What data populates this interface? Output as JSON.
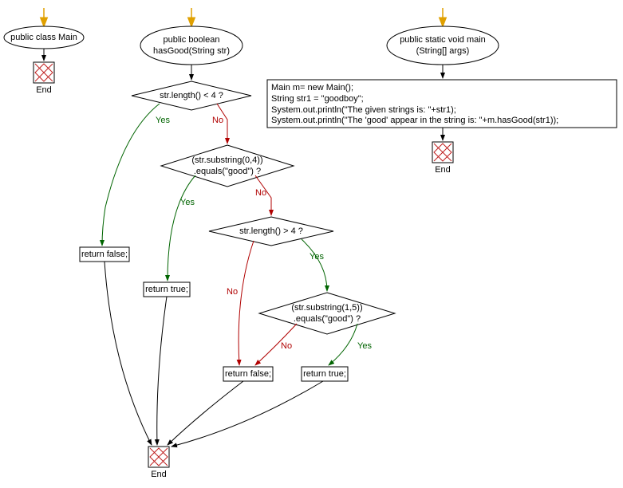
{
  "flowchart": {
    "nodes": {
      "class_decl": "public class Main",
      "method_hasGood": "public boolean\nhasGood(String str)",
      "method_main": "public static void main\n(String[] args)",
      "cond1": "str.length() < 4 ?",
      "cond2": "(str.substring(0,4))\n.equals(\"good\") ?",
      "cond3": "str.length() > 4 ?",
      "cond4": "(str.substring(1,5))\n.equals(\"good\") ?",
      "ret_false_1": "return false;",
      "ret_true_1": "return true;",
      "ret_false_2": "return false;",
      "ret_true_2": "return true;",
      "main_body": "Main m= new Main();\nString str1 = \"goodboy\";\nSystem.out.println(\"The given strings is: \"+str1);\nSystem.out.println(\"The 'good' appear in the string is: \"+m.hasGood(str1));",
      "end": "End"
    },
    "labels": {
      "yes": "Yes",
      "no": "No"
    },
    "colors": {
      "yes": "#006400",
      "no": "#b00000",
      "node_stroke": "#000000",
      "end_fill": "#ffffff",
      "end_cross": "#c02020",
      "arrow_enter": "#e0a000"
    }
  }
}
